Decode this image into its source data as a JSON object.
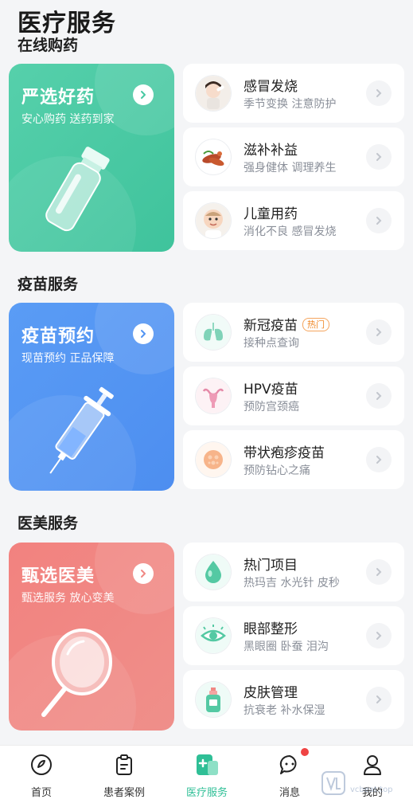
{
  "page_title": "医疗服务",
  "sections": {
    "online": {
      "title": "在线购药"
    },
    "vaccine": {
      "title": "疫苗服务"
    },
    "beauty": {
      "title": "医美服务"
    }
  },
  "online_card": {
    "title": "严选好药",
    "subtitle": "安心购药 送药到家",
    "accent": "#48c8a2"
  },
  "vaccine_card": {
    "title": "疫苗预约",
    "subtitle": "现苗预约 正品保障",
    "accent": "#5294f2"
  },
  "beauty_card": {
    "title": "甄选医美",
    "subtitle": "甄选服务 放心变美",
    "accent": "#f08884"
  },
  "online_items": [
    {
      "title": "感冒发烧",
      "subtitle": "季节变换 注意防护",
      "icon": "sick-child-icon"
    },
    {
      "title": "滋补补益",
      "subtitle": "强身健体 调理养生",
      "icon": "tonic-herbs-icon"
    },
    {
      "title": "儿童用药",
      "subtitle": "消化不良 感冒发烧",
      "icon": "baby-icon"
    }
  ],
  "vaccine_items": [
    {
      "title": "新冠疫苗",
      "badge": "热门",
      "subtitle": "接种点查询",
      "icon": "lungs-icon"
    },
    {
      "title": "HPV疫苗",
      "subtitle": "预防宫颈癌",
      "icon": "uterus-icon"
    },
    {
      "title": "带状疱疹疫苗",
      "subtitle": "预防钻心之痛",
      "icon": "herpes-icon"
    }
  ],
  "beauty_items": [
    {
      "title": "热门项目",
      "subtitle": "热玛吉 水光针 皮秒",
      "icon": "droplet-icon"
    },
    {
      "title": "眼部整形",
      "subtitle": "黑眼圈 卧蚕 泪沟",
      "icon": "eye-icon"
    },
    {
      "title": "皮肤管理",
      "subtitle": "抗衰老 补水保湿",
      "icon": "skincare-bottle-icon"
    }
  ],
  "tabbar": [
    {
      "label": "首页",
      "icon": "home-icon",
      "active": false
    },
    {
      "label": "患者案例",
      "icon": "clipboard-icon",
      "active": false
    },
    {
      "label": "医疗服务",
      "icon": "medical-service-icon",
      "active": true
    },
    {
      "label": "消息",
      "icon": "message-icon",
      "active": false
    },
    {
      "label": "我的",
      "icon": "profile-icon",
      "active": false
    }
  ],
  "watermark": {
    "text": "vcbeat.top"
  },
  "colors": {
    "active_tab": "#2fbf96",
    "badge": "#f08a2a",
    "notification_dot": "#ef4444"
  }
}
